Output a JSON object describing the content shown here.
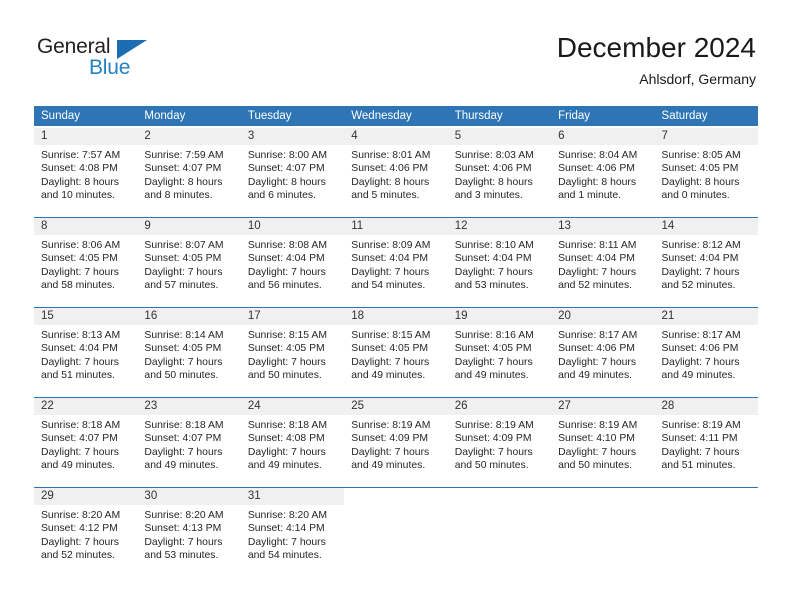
{
  "logo": {
    "word_top": "General",
    "word_bottom": "Blue",
    "triangle_color": "#1b6cb0",
    "blue_text_color": "#2382c6"
  },
  "header": {
    "title": "December 2024",
    "subtitle": "Ahlsdorf, Germany"
  },
  "theme": {
    "header_blue": "#2e75b6",
    "daynum_bg": "#f0f0f0",
    "text": "#262626"
  },
  "weekday_headers": [
    "Sunday",
    "Monday",
    "Tuesday",
    "Wednesday",
    "Thursday",
    "Friday",
    "Saturday"
  ],
  "weeks": [
    [
      {
        "day": "1",
        "sunrise": "Sunrise: 7:57 AM",
        "sunset": "Sunset: 4:08 PM",
        "daylight1": "Daylight: 8 hours",
        "daylight2": "and 10 minutes."
      },
      {
        "day": "2",
        "sunrise": "Sunrise: 7:59 AM",
        "sunset": "Sunset: 4:07 PM",
        "daylight1": "Daylight: 8 hours",
        "daylight2": "and 8 minutes."
      },
      {
        "day": "3",
        "sunrise": "Sunrise: 8:00 AM",
        "sunset": "Sunset: 4:07 PM",
        "daylight1": "Daylight: 8 hours",
        "daylight2": "and 6 minutes."
      },
      {
        "day": "4",
        "sunrise": "Sunrise: 8:01 AM",
        "sunset": "Sunset: 4:06 PM",
        "daylight1": "Daylight: 8 hours",
        "daylight2": "and 5 minutes."
      },
      {
        "day": "5",
        "sunrise": "Sunrise: 8:03 AM",
        "sunset": "Sunset: 4:06 PM",
        "daylight1": "Daylight: 8 hours",
        "daylight2": "and 3 minutes."
      },
      {
        "day": "6",
        "sunrise": "Sunrise: 8:04 AM",
        "sunset": "Sunset: 4:06 PM",
        "daylight1": "Daylight: 8 hours",
        "daylight2": "and 1 minute."
      },
      {
        "day": "7",
        "sunrise": "Sunrise: 8:05 AM",
        "sunset": "Sunset: 4:05 PM",
        "daylight1": "Daylight: 8 hours",
        "daylight2": "and 0 minutes."
      }
    ],
    [
      {
        "day": "8",
        "sunrise": "Sunrise: 8:06 AM",
        "sunset": "Sunset: 4:05 PM",
        "daylight1": "Daylight: 7 hours",
        "daylight2": "and 58 minutes."
      },
      {
        "day": "9",
        "sunrise": "Sunrise: 8:07 AM",
        "sunset": "Sunset: 4:05 PM",
        "daylight1": "Daylight: 7 hours",
        "daylight2": "and 57 minutes."
      },
      {
        "day": "10",
        "sunrise": "Sunrise: 8:08 AM",
        "sunset": "Sunset: 4:04 PM",
        "daylight1": "Daylight: 7 hours",
        "daylight2": "and 56 minutes."
      },
      {
        "day": "11",
        "sunrise": "Sunrise: 8:09 AM",
        "sunset": "Sunset: 4:04 PM",
        "daylight1": "Daylight: 7 hours",
        "daylight2": "and 54 minutes."
      },
      {
        "day": "12",
        "sunrise": "Sunrise: 8:10 AM",
        "sunset": "Sunset: 4:04 PM",
        "daylight1": "Daylight: 7 hours",
        "daylight2": "and 53 minutes."
      },
      {
        "day": "13",
        "sunrise": "Sunrise: 8:11 AM",
        "sunset": "Sunset: 4:04 PM",
        "daylight1": "Daylight: 7 hours",
        "daylight2": "and 52 minutes."
      },
      {
        "day": "14",
        "sunrise": "Sunrise: 8:12 AM",
        "sunset": "Sunset: 4:04 PM",
        "daylight1": "Daylight: 7 hours",
        "daylight2": "and 52 minutes."
      }
    ],
    [
      {
        "day": "15",
        "sunrise": "Sunrise: 8:13 AM",
        "sunset": "Sunset: 4:04 PM",
        "daylight1": "Daylight: 7 hours",
        "daylight2": "and 51 minutes."
      },
      {
        "day": "16",
        "sunrise": "Sunrise: 8:14 AM",
        "sunset": "Sunset: 4:05 PM",
        "daylight1": "Daylight: 7 hours",
        "daylight2": "and 50 minutes."
      },
      {
        "day": "17",
        "sunrise": "Sunrise: 8:15 AM",
        "sunset": "Sunset: 4:05 PM",
        "daylight1": "Daylight: 7 hours",
        "daylight2": "and 50 minutes."
      },
      {
        "day": "18",
        "sunrise": "Sunrise: 8:15 AM",
        "sunset": "Sunset: 4:05 PM",
        "daylight1": "Daylight: 7 hours",
        "daylight2": "and 49 minutes."
      },
      {
        "day": "19",
        "sunrise": "Sunrise: 8:16 AM",
        "sunset": "Sunset: 4:05 PM",
        "daylight1": "Daylight: 7 hours",
        "daylight2": "and 49 minutes."
      },
      {
        "day": "20",
        "sunrise": "Sunrise: 8:17 AM",
        "sunset": "Sunset: 4:06 PM",
        "daylight1": "Daylight: 7 hours",
        "daylight2": "and 49 minutes."
      },
      {
        "day": "21",
        "sunrise": "Sunrise: 8:17 AM",
        "sunset": "Sunset: 4:06 PM",
        "daylight1": "Daylight: 7 hours",
        "daylight2": "and 49 minutes."
      }
    ],
    [
      {
        "day": "22",
        "sunrise": "Sunrise: 8:18 AM",
        "sunset": "Sunset: 4:07 PM",
        "daylight1": "Daylight: 7 hours",
        "daylight2": "and 49 minutes."
      },
      {
        "day": "23",
        "sunrise": "Sunrise: 8:18 AM",
        "sunset": "Sunset: 4:07 PM",
        "daylight1": "Daylight: 7 hours",
        "daylight2": "and 49 minutes."
      },
      {
        "day": "24",
        "sunrise": "Sunrise: 8:18 AM",
        "sunset": "Sunset: 4:08 PM",
        "daylight1": "Daylight: 7 hours",
        "daylight2": "and 49 minutes."
      },
      {
        "day": "25",
        "sunrise": "Sunrise: 8:19 AM",
        "sunset": "Sunset: 4:09 PM",
        "daylight1": "Daylight: 7 hours",
        "daylight2": "and 49 minutes."
      },
      {
        "day": "26",
        "sunrise": "Sunrise: 8:19 AM",
        "sunset": "Sunset: 4:09 PM",
        "daylight1": "Daylight: 7 hours",
        "daylight2": "and 50 minutes."
      },
      {
        "day": "27",
        "sunrise": "Sunrise: 8:19 AM",
        "sunset": "Sunset: 4:10 PM",
        "daylight1": "Daylight: 7 hours",
        "daylight2": "and 50 minutes."
      },
      {
        "day": "28",
        "sunrise": "Sunrise: 8:19 AM",
        "sunset": "Sunset: 4:11 PM",
        "daylight1": "Daylight: 7 hours",
        "daylight2": "and 51 minutes."
      }
    ],
    [
      {
        "day": "29",
        "sunrise": "Sunrise: 8:20 AM",
        "sunset": "Sunset: 4:12 PM",
        "daylight1": "Daylight: 7 hours",
        "daylight2": "and 52 minutes."
      },
      {
        "day": "30",
        "sunrise": "Sunrise: 8:20 AM",
        "sunset": "Sunset: 4:13 PM",
        "daylight1": "Daylight: 7 hours",
        "daylight2": "and 53 minutes."
      },
      {
        "day": "31",
        "sunrise": "Sunrise: 8:20 AM",
        "sunset": "Sunset: 4:14 PM",
        "daylight1": "Daylight: 7 hours",
        "daylight2": "and 54 minutes."
      },
      {
        "day": "",
        "sunrise": "",
        "sunset": "",
        "daylight1": "",
        "daylight2": ""
      },
      {
        "day": "",
        "sunrise": "",
        "sunset": "",
        "daylight1": "",
        "daylight2": ""
      },
      {
        "day": "",
        "sunrise": "",
        "sunset": "",
        "daylight1": "",
        "daylight2": ""
      },
      {
        "day": "",
        "sunrise": "",
        "sunset": "",
        "daylight1": "",
        "daylight2": ""
      }
    ]
  ]
}
